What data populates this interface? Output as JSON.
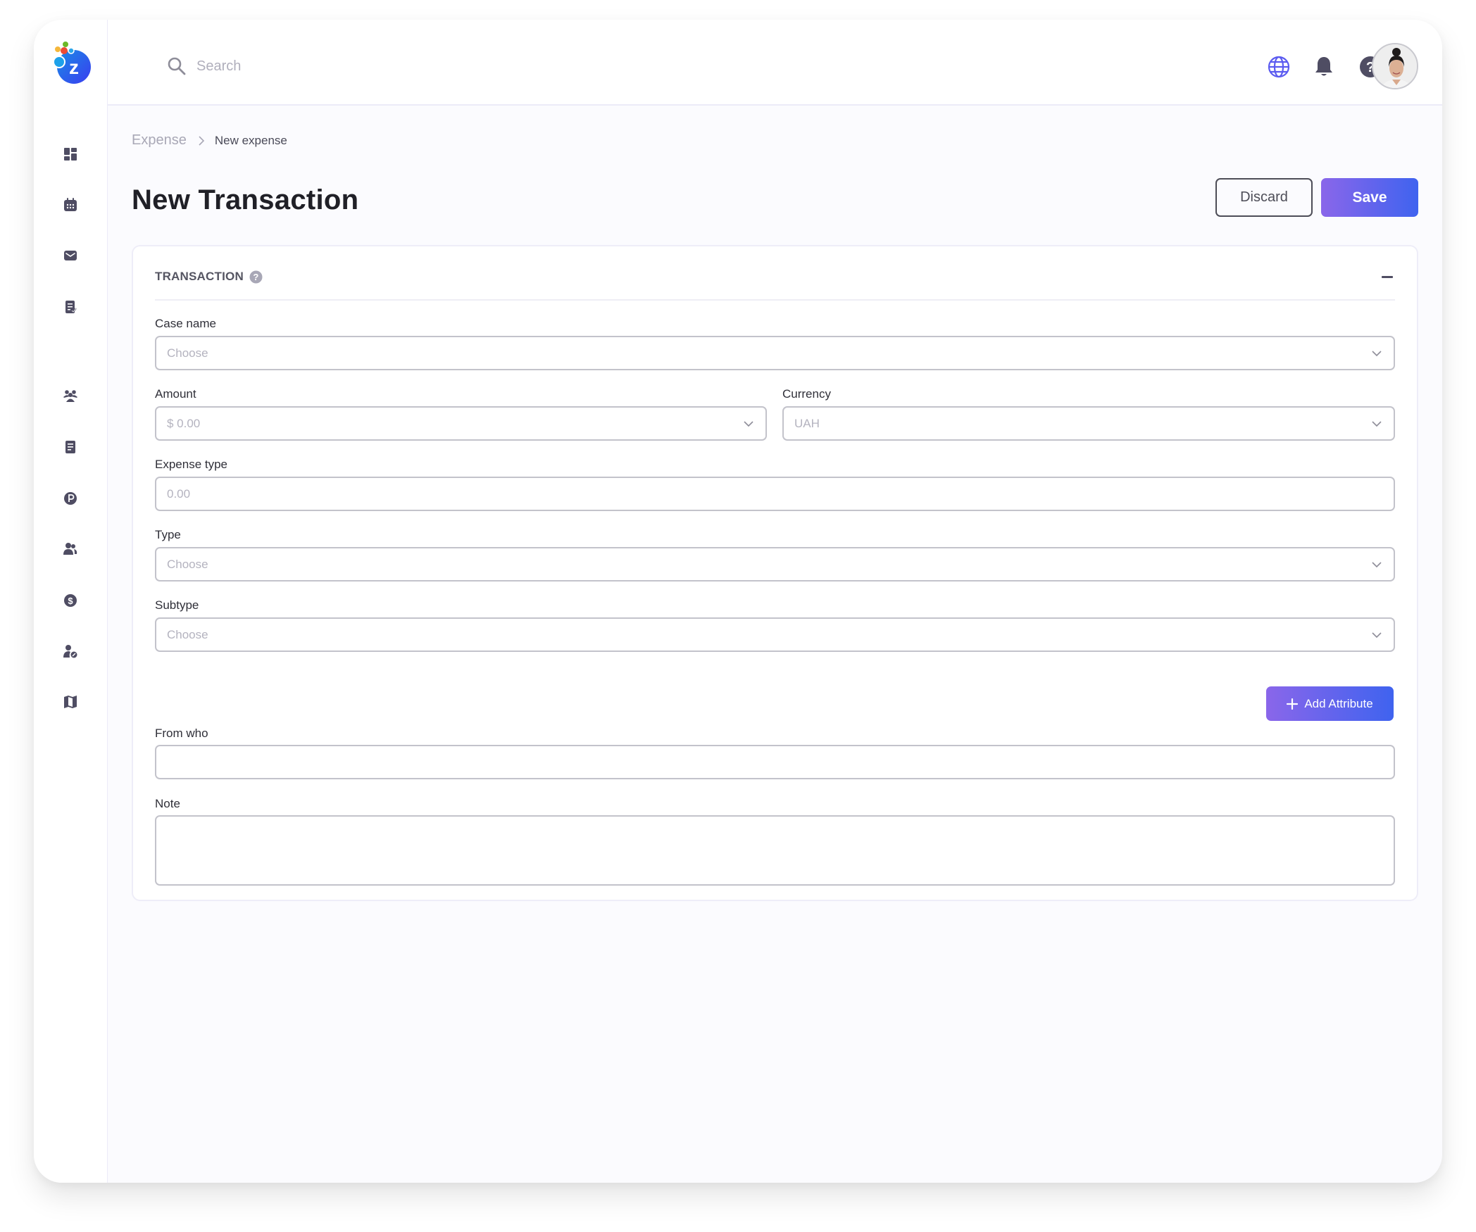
{
  "app": {
    "brand_letter": "z",
    "colors": {
      "accent_start": "#8a66ea",
      "accent_end": "#3f63ef",
      "icon": "#4f4d63",
      "globe": "#5b5bf0"
    }
  },
  "sidebar": {
    "items": [
      {
        "name": "dashboard",
        "icon": "dashboard-icon"
      },
      {
        "name": "calendar",
        "icon": "calendar-icon"
      },
      {
        "name": "mail",
        "icon": "mail-icon"
      },
      {
        "name": "tasks",
        "icon": "checklist-icon"
      },
      {
        "name": "groups",
        "icon": "group-icon"
      },
      {
        "name": "documents",
        "icon": "document-icon"
      },
      {
        "name": "parking",
        "icon": "p-circle-icon"
      },
      {
        "name": "contacts",
        "icon": "users-icon"
      },
      {
        "name": "finance",
        "icon": "dollar-icon"
      },
      {
        "name": "user-settings",
        "icon": "user-edit-icon"
      },
      {
        "name": "map",
        "icon": "map-icon"
      }
    ]
  },
  "header": {
    "search_placeholder": "Search",
    "icons": [
      "globe-icon",
      "bell-icon",
      "help-icon"
    ],
    "avatar_alt": "User avatar"
  },
  "breadcrumb": {
    "parent": "Expense",
    "current": "New expense"
  },
  "page": {
    "title": "New Transaction",
    "discard_label": "Discard",
    "save_label": "Save"
  },
  "form": {
    "section_title": "TRANSACTION",
    "fields": {
      "case_name": {
        "label": "Case name",
        "placeholder": "Choose"
      },
      "amount": {
        "label": "Amount",
        "placeholder": "$ 0.00"
      },
      "currency": {
        "label": "Currency",
        "placeholder": "UAH"
      },
      "expense_type": {
        "label": "Expense type",
        "placeholder": "0.00"
      },
      "type": {
        "label": "Type",
        "placeholder": "Choose"
      },
      "subtype": {
        "label": "Subtype",
        "placeholder": "Choose"
      },
      "from_who": {
        "label": "From who",
        "value": ""
      },
      "note": {
        "label": "Note",
        "value": ""
      }
    },
    "add_attribute_label": "Add Attribute"
  }
}
